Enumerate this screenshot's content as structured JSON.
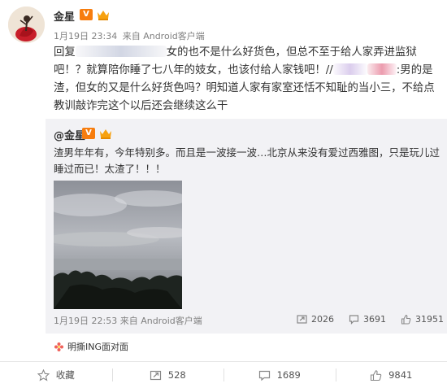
{
  "post": {
    "author": "金星",
    "verified_badge": "V",
    "time": "1月19日 23:34",
    "source": "来自 Android客户端",
    "text_part1": "回复",
    "text_part2": "女的也不是什么好货色，但总不至于给人家弄进监狱吧！？就算陪你睡了七八年的妓女，也该付给人家钱吧！//",
    "text_part3": ":男的是渣，但女的又是什么好货色吗？明知道人家有家室还恬不知耻的当小三，不给点教训敲诈完这个以后还会继续这么干"
  },
  "repost": {
    "author": "@金星",
    "verified_badge": "V",
    "text": "渣男年年有，今年特别多。而且是一波接一波…北京从来没有爱过西雅图，只是玩儿过睡过而已！太渣了！！！",
    "time": "1月19日 22:53",
    "source": "来自 Android客户端",
    "reposts": "2026",
    "comments": "3691",
    "likes": "31951"
  },
  "topic": {
    "label": "明撕ING面对面"
  },
  "actions": {
    "favorite": "收藏",
    "repost": "528",
    "comment": "1689",
    "like": "9841"
  },
  "colors": {
    "badge_orange": "#f77d0e",
    "repost_bg": "#f2f2f5",
    "meta_gray": "#808080"
  }
}
